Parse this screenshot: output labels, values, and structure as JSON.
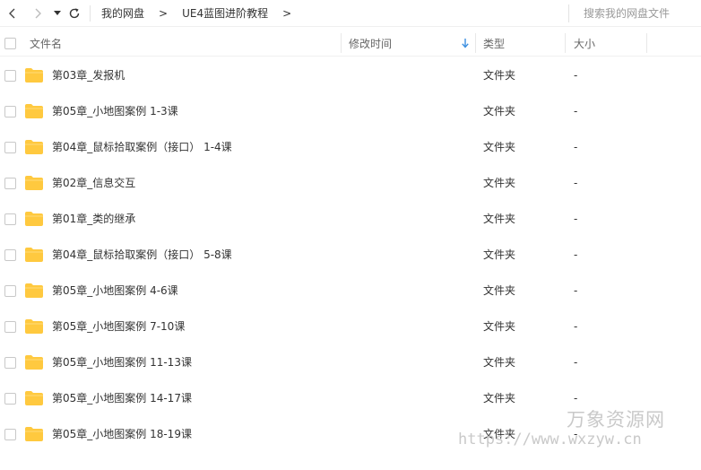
{
  "nav": {
    "back_icon": "chevron-left-icon",
    "forward_icon": "chevron-right-icon",
    "history_icon": "caret-down-icon",
    "refresh_icon": "refresh-icon",
    "breadcrumb": [
      "我的网盘",
      "UE4蓝图进阶教程"
    ],
    "breadcrumb_separator": ">",
    "search_placeholder": "搜索我的网盘文件"
  },
  "columns": {
    "name": "文件名",
    "modified": "修改时间",
    "type": "类型",
    "size": "大小",
    "sort_icon": "arrow-down-icon",
    "sort_color": "#3b8fe0"
  },
  "folder_color": "#ffc93f",
  "files": [
    {
      "name": "第03章_发报机",
      "type": "文件夹",
      "size": "-"
    },
    {
      "name": "第05章_小地图案例 1-3课",
      "type": "文件夹",
      "size": "-"
    },
    {
      "name": "第04章_鼠标拾取案例（接口） 1-4课",
      "type": "文件夹",
      "size": "-"
    },
    {
      "name": "第02章_信息交互",
      "type": "文件夹",
      "size": "-"
    },
    {
      "name": "第01章_类的继承",
      "type": "文件夹",
      "size": "-"
    },
    {
      "name": "第04章_鼠标拾取案例（接口） 5-8课",
      "type": "文件夹",
      "size": "-"
    },
    {
      "name": "第05章_小地图案例 4-6课",
      "type": "文件夹",
      "size": "-"
    },
    {
      "name": "第05章_小地图案例 7-10课",
      "type": "文件夹",
      "size": "-"
    },
    {
      "name": "第05章_小地图案例 11-13课",
      "type": "文件夹",
      "size": "-"
    },
    {
      "name": "第05章_小地图案例 14-17课",
      "type": "文件夹",
      "size": "-"
    },
    {
      "name": "第05章_小地图案例 18-19课",
      "type": "文件夹",
      "size": "-"
    }
  ],
  "watermark": {
    "title": "万象资源网",
    "url": "https://www.wxzyw.cn"
  }
}
